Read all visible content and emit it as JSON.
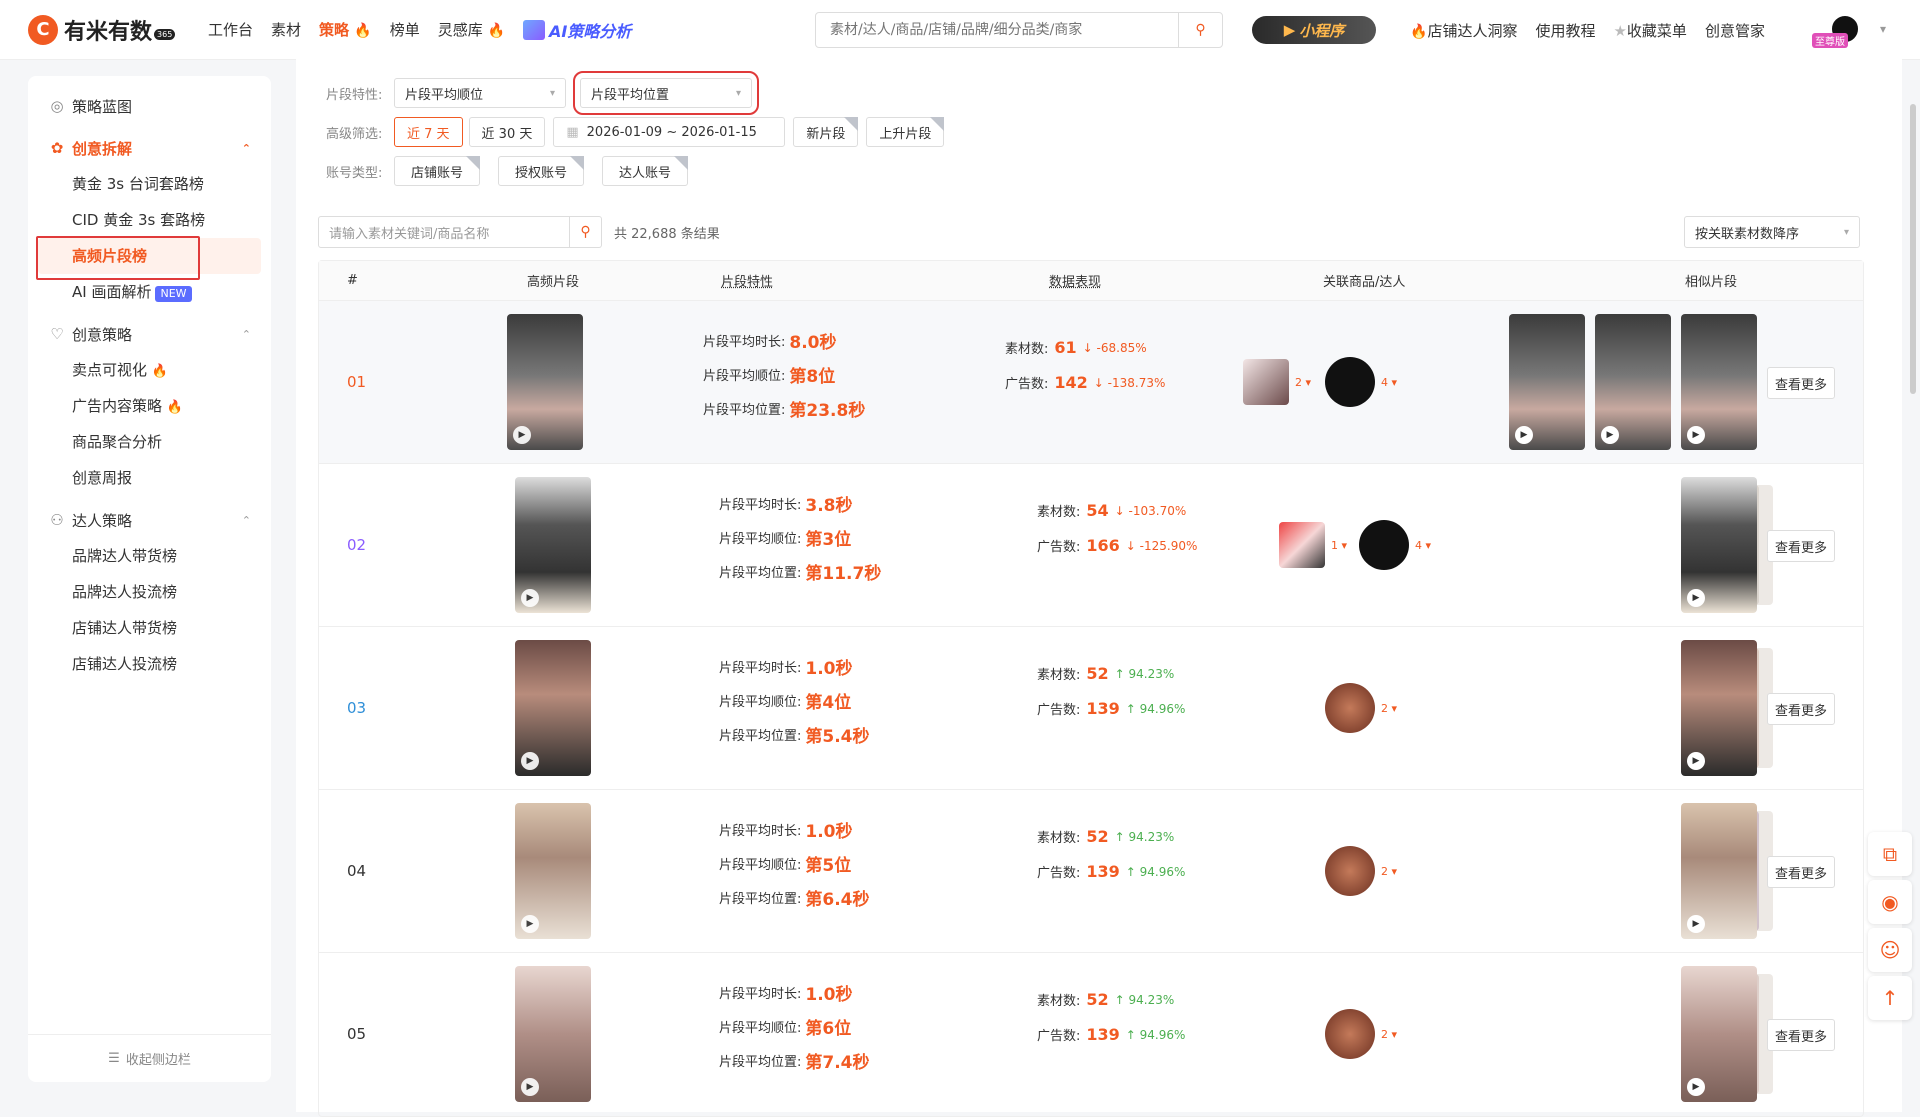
{
  "app": {
    "name": "有米有数",
    "badge": "365"
  },
  "nav": [
    {
      "label": "工作台"
    },
    {
      "label": "素材"
    },
    {
      "label": "策略",
      "active": true,
      "fire": true
    },
    {
      "label": "榜单"
    },
    {
      "label": "灵感库",
      "fire": true
    }
  ],
  "ai_nav": "AI策略分析",
  "search": {
    "placeholder": "素材/达人/商品/店铺/品牌/细分品类/商家"
  },
  "mini_program": "小程序",
  "top_right": [
    "店铺达人洞察",
    "使用教程",
    "收藏菜单",
    "创意管家"
  ],
  "vip": "至尊版",
  "sidebar": {
    "blueprint": "策略蓝图",
    "group1": {
      "title": "创意拆解",
      "items": [
        "黄金 3s 台词套路榜",
        "CID 黄金 3s 套路榜",
        "高频片段榜",
        "AI 画面解析"
      ],
      "new": "NEW"
    },
    "group2": {
      "title": "创意策略",
      "items": [
        "卖点可视化",
        "广告内容策略",
        "商品聚合分析",
        "创意周报"
      ]
    },
    "group3": {
      "title": "达人策略",
      "items": [
        "品牌达人带货榜",
        "品牌达人投流榜",
        "店铺达人带货榜",
        "店铺达人投流榜"
      ]
    },
    "collapse": "收起侧边栏"
  },
  "filters": {
    "feature_label": "片段特性:",
    "feature_sel1": "片段平均顺位",
    "feature_sel2": "片段平均位置",
    "adv_label": "高级筛选:",
    "range7": "近 7 天",
    "range30": "近 30 天",
    "date": "2026-01-09 ~ 2026-01-15",
    "new_seg": "新片段",
    "rising_seg": "上升片段",
    "acct_label": "账号类型:",
    "acct": [
      "店铺账号",
      "授权账号",
      "达人账号"
    ]
  },
  "keyword": {
    "placeholder": "请输入素材关键词/商品名称",
    "count": "共 22,688 条结果"
  },
  "sort": "按关联素材数降序",
  "table": {
    "headers": [
      "#",
      "高频片段",
      "片段特性",
      "数据表现",
      "关联商品/达人",
      "相似片段"
    ],
    "labels": {
      "duration": "片段平均时长:",
      "rank": "片段平均顺位:",
      "position": "片段平均位置:",
      "material": "素材数:",
      "ads": "广告数:",
      "more": "查看更多"
    },
    "rows": [
      {
        "idx": "01",
        "duration": "8.0秒",
        "rank": "第8位",
        "position": "第23.8秒",
        "material": "61",
        "material_chg": "↓ -68.85%",
        "ads": "142",
        "ads_chg": "↓ -138.73%",
        "dir": "down",
        "prod_count": "2",
        "kol_count": "4"
      },
      {
        "idx": "02",
        "duration": "3.8秒",
        "rank": "第3位",
        "position": "第11.7秒",
        "material": "54",
        "material_chg": "↓ -103.70%",
        "ads": "166",
        "ads_chg": "↓ -125.90%",
        "dir": "down",
        "prod_count": "1",
        "kol_count": "4"
      },
      {
        "idx": "03",
        "duration": "1.0秒",
        "rank": "第4位",
        "position": "第5.4秒",
        "material": "52",
        "material_chg": "↑ 94.23%",
        "ads": "139",
        "ads_chg": "↑ 94.96%",
        "dir": "up",
        "kol_count": "2"
      },
      {
        "idx": "04",
        "duration": "1.0秒",
        "rank": "第5位",
        "position": "第6.4秒",
        "material": "52",
        "material_chg": "↑ 94.23%",
        "ads": "139",
        "ads_chg": "↑ 94.96%",
        "dir": "up",
        "kol_count": "2"
      },
      {
        "idx": "05",
        "duration": "1.0秒",
        "rank": "第6位",
        "position": "第7.4秒",
        "material": "52",
        "material_chg": "↑ 94.23%",
        "ads": "139",
        "ads_chg": "↑ 94.96%",
        "dir": "up",
        "kol_count": "2"
      }
    ]
  },
  "colors": {
    "accent": "#f15a22",
    "up": "#4caf50",
    "ai": "#4a5cff"
  }
}
